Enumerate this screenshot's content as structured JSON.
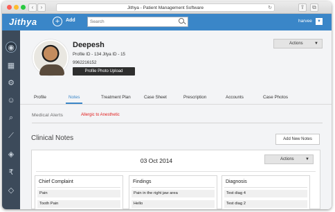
{
  "browser": {
    "title": "Jithya - Patient Management Software",
    "back_glyph": "‹",
    "forward_glyph": "›",
    "reload_glyph": "↻"
  },
  "header": {
    "logo": "Jithya",
    "add_label": "Add",
    "add_glyph": "+",
    "search_placeholder": "Search",
    "username": "harvee",
    "dropdown_glyph": "▼"
  },
  "sidebar": {
    "items": [
      {
        "icon": "dashboard-icon",
        "glyph": "◉",
        "active": true
      },
      {
        "icon": "calendar-icon",
        "glyph": "▦"
      },
      {
        "icon": "settings-icon",
        "glyph": "⚙"
      },
      {
        "icon": "user-icon",
        "glyph": "☺"
      },
      {
        "icon": "search-icon",
        "glyph": "⌕"
      },
      {
        "icon": "chart-icon",
        "glyph": "⟋"
      },
      {
        "icon": "tag-icon",
        "glyph": "◈"
      },
      {
        "icon": "rupee-icon",
        "glyph": "₹"
      },
      {
        "icon": "sales-tag-icon",
        "glyph": "◇"
      }
    ]
  },
  "patient": {
    "name": "Deepesh",
    "id_line": "Profile ID - 134  Jitya ID - 15",
    "phone": "9962216152",
    "upload_label": "Profile Photo Upload",
    "actions_label": "Actions",
    "caret": "▼"
  },
  "tabs": [
    {
      "label": "Profile"
    },
    {
      "label": "Notes",
      "active": true
    },
    {
      "label": "Treatment Plan"
    },
    {
      "label": "Case Sheet"
    },
    {
      "label": "Prescription"
    },
    {
      "label": "Accounts"
    },
    {
      "label": "Case Photos"
    }
  ],
  "alerts": {
    "label": "Medical Alerts",
    "value": "Allergic to Anesthetic"
  },
  "notes": {
    "title": "Clinical Notes",
    "add_label": "Add New Notes",
    "card": {
      "date": "03 Oct 2014",
      "actions_label": "Actions",
      "columns": [
        {
          "title": "Chief Complaint",
          "rows": [
            "Pain",
            "Tooth Pain"
          ]
        },
        {
          "title": "Findings",
          "rows": [
            "Pain in the right jaw area",
            "Hello"
          ]
        },
        {
          "title": "Diagnosis",
          "rows": [
            "Test diag 4",
            "Test diag 2"
          ]
        }
      ]
    }
  },
  "colors": {
    "accent": "#3a86c8",
    "sidebar": "#3c4a5a",
    "alert": "#e01b1b"
  }
}
